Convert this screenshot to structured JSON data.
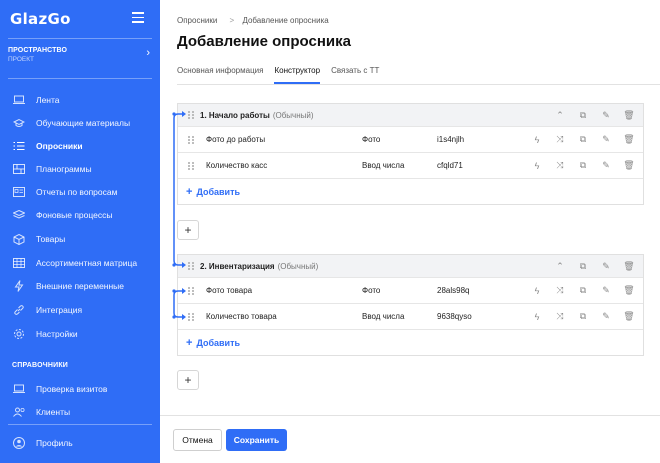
{
  "app": {
    "logo": "GlazGo"
  },
  "sidebar": {
    "space_title": "ПРОСТРАНСТВО",
    "space_subtitle": "ПРОЕКТ",
    "items": [
      {
        "label": "Лента",
        "icon": "laptop-icon"
      },
      {
        "label": "Обучающие материалы",
        "icon": "graduation-cap-icon"
      },
      {
        "label": "Опросники",
        "icon": "list-icon"
      },
      {
        "label": "Планограммы",
        "icon": "shelves-icon"
      },
      {
        "label": "Отчеты по вопросам",
        "icon": "id-card-icon"
      },
      {
        "label": "Фоновые процессы",
        "icon": "layers-icon"
      },
      {
        "label": "Товары",
        "icon": "box-icon"
      },
      {
        "label": "Ассортиментная матрица",
        "icon": "grid-icon"
      },
      {
        "label": "Внешние переменные",
        "icon": "lightning-icon"
      },
      {
        "label": "Интеграция",
        "icon": "link-icon"
      },
      {
        "label": "Настройки",
        "icon": "gear-icon"
      }
    ],
    "reference_title": "СПРАВОЧНИКИ",
    "reference_items": [
      {
        "label": "Проверка визитов",
        "icon": "laptop-icon"
      },
      {
        "label": "Клиенты",
        "icon": "users-icon"
      }
    ],
    "profile_label": "Профиль"
  },
  "breadcrumb": {
    "parent": "Опросники",
    "separator": ">",
    "current": "Добавление опросника"
  },
  "page_title": "Добавление опросника",
  "tabs": [
    {
      "label": "Основная информация",
      "active": false
    },
    {
      "label": "Конструктор",
      "active": true
    },
    {
      "label": "Связать с ТТ",
      "active": false
    }
  ],
  "groups": [
    {
      "title": "1. Начало работы",
      "type": "(Обычный)",
      "rows": [
        {
          "name": "Фото до работы",
          "type": "Фото",
          "code": "i1s4njlh"
        },
        {
          "name": "Количество касс",
          "type": "Ввод числа",
          "code": "cfqld71"
        }
      ],
      "add_label": "Добавить"
    },
    {
      "title": "2. Инвентаризация",
      "type": "(Обычный)",
      "rows": [
        {
          "name": "Фото товара",
          "type": "Фото",
          "code": "28als98q"
        },
        {
          "name": "Количество товара",
          "type": "Ввод числа",
          "code": "9638qyso"
        }
      ],
      "add_label": "Добавить"
    }
  ],
  "footer": {
    "cancel_label": "Отмена",
    "save_label": "Сохранить"
  },
  "colors": {
    "accent": "#2f6df6"
  }
}
